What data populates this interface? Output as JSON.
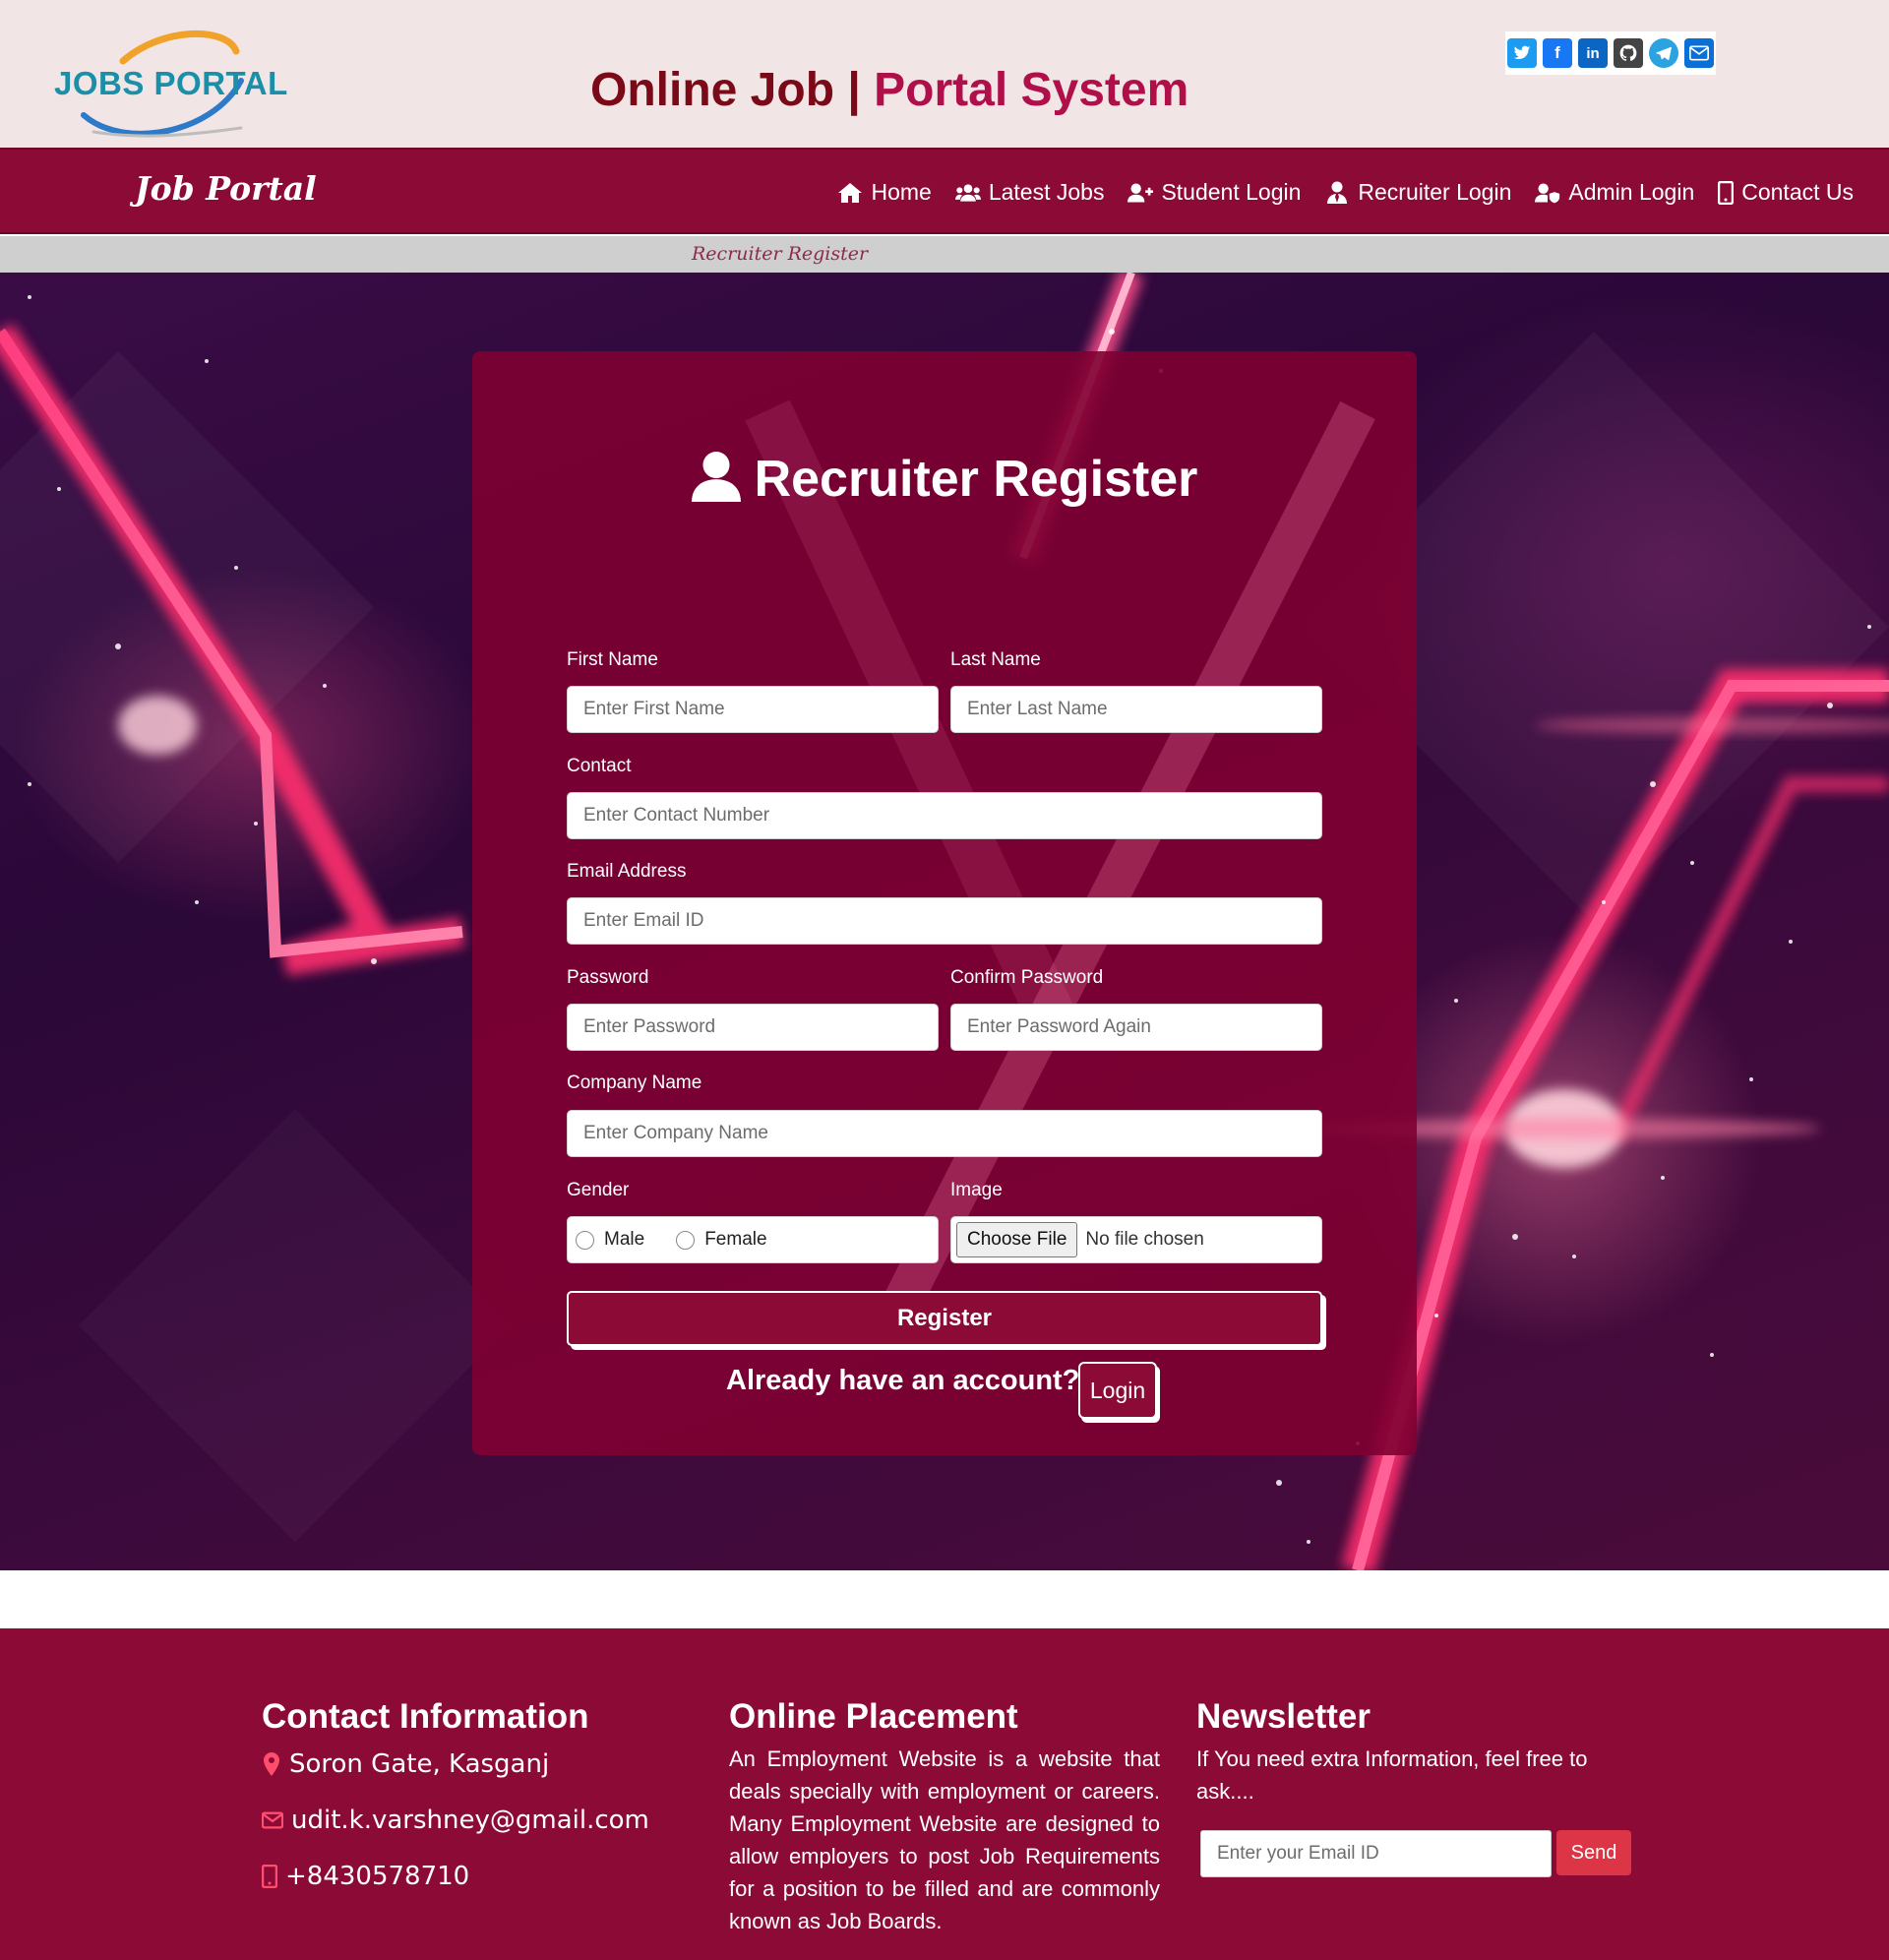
{
  "header": {
    "logo_text": "JOBS PORTAL",
    "title_part1": "Online Job | ",
    "title_part2": "Portal System",
    "social_icons": [
      "twitter-icon",
      "facebook-icon",
      "linkedin-icon",
      "github-icon",
      "telegram-icon",
      "email-icon"
    ]
  },
  "navbar": {
    "brand": "Job Portal",
    "items": [
      {
        "label": "Home",
        "icon": "home-icon"
      },
      {
        "label": "Latest Jobs",
        "icon": "users-icon"
      },
      {
        "label": "Student Login",
        "icon": "user-plus-icon"
      },
      {
        "label": "Recruiter Login",
        "icon": "user-tie-icon"
      },
      {
        "label": "Admin Login",
        "icon": "user-shield-icon"
      },
      {
        "label": "Contact Us",
        "icon": "mobile-icon"
      }
    ]
  },
  "breadcrumb": "Recruiter Register",
  "form": {
    "title": "Recruiter Register",
    "first_name": {
      "label": "First Name",
      "placeholder": "Enter First Name"
    },
    "last_name": {
      "label": "Last Name",
      "placeholder": "Enter Last Name"
    },
    "contact": {
      "label": "Contact",
      "placeholder": "Enter Contact Number"
    },
    "email": {
      "label": "Email Address",
      "placeholder": "Enter Email ID"
    },
    "password": {
      "label": "Password",
      "placeholder": "Enter Password"
    },
    "confirm_password": {
      "label": "Confirm Password",
      "placeholder": "Enter Password Again"
    },
    "company": {
      "label": "Company Name",
      "placeholder": "Enter Company Name"
    },
    "gender": {
      "label": "Gender",
      "options": [
        "Male",
        "Female"
      ]
    },
    "image": {
      "label": "Image",
      "button": "Choose File",
      "status": "No file chosen"
    },
    "register_button": "Register",
    "already_text": "Already have an account?",
    "login_button": "Login"
  },
  "footer": {
    "contact_heading": "Contact Information",
    "address": "Soron Gate, Kasganj",
    "email": "udit.k.varshney@gmail.com",
    "phone": "+8430578710",
    "placement_heading": "Online Placement",
    "placement_text": "An Employment Website is a website that deals specially with employment or careers. Many Employment Website are designed to allow employers to post Job Requirements for a position to be filled and are commonly known as Job Boards.",
    "newsletter_heading": "Newsletter",
    "newsletter_text": "If You need extra Information, feel free to ask....",
    "newsletter_placeholder": "Enter your Email ID",
    "send_button": "Send"
  },
  "colors": {
    "primary": "#8c0a36",
    "header_bg": "#f2e5e6",
    "title_dark": "#7a0a17",
    "title_accent": "#b0104a",
    "send_button": "#dc3545"
  }
}
